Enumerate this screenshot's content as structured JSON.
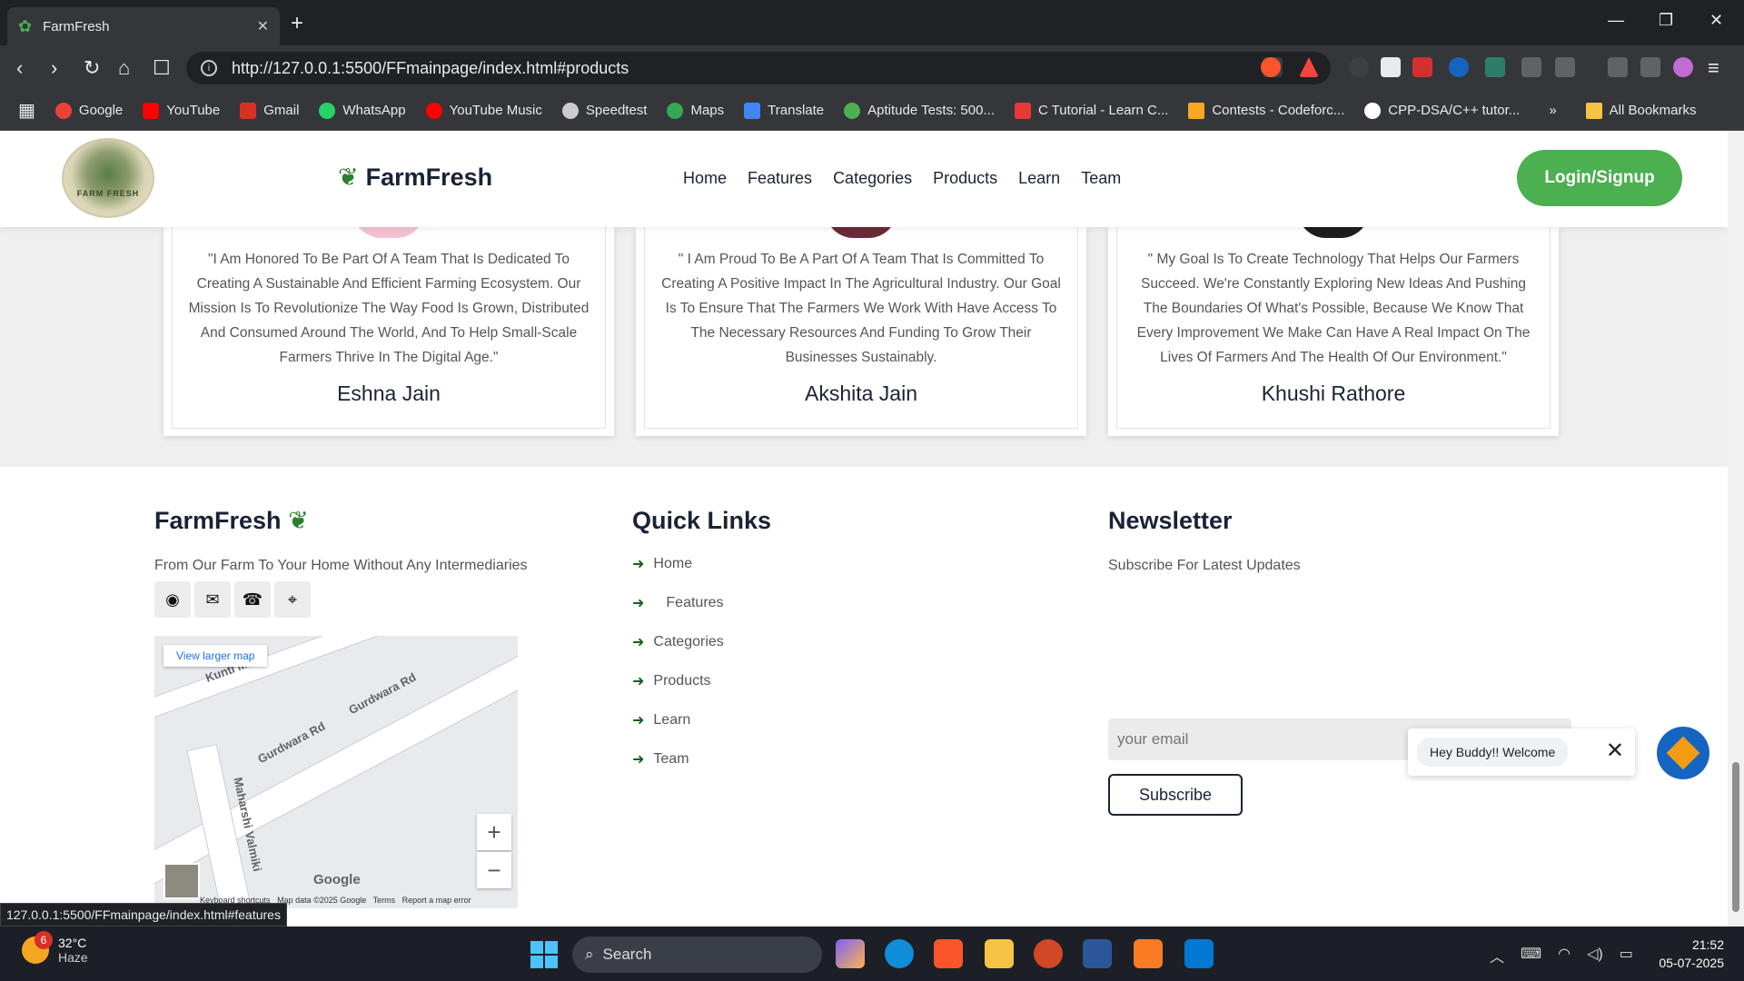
{
  "browser": {
    "tab_title": "FarmFresh",
    "url": "http://127.0.0.1:5500/FFmainpage/index.html#products",
    "status_url": "127.0.0.1:5500/FFmainpage/index.html#features",
    "bookmarks": [
      {
        "label": "Google",
        "color": "#ea4335"
      },
      {
        "label": "YouTube",
        "color": "#ff0000"
      },
      {
        "label": "Gmail",
        "color": "#d93025"
      },
      {
        "label": "WhatsApp",
        "color": "#25d366"
      },
      {
        "label": "YouTube Music",
        "color": "#ff0000"
      },
      {
        "label": "Speedtest",
        "color": "#cccccc"
      },
      {
        "label": "Maps",
        "color": "#34a853"
      },
      {
        "label": "Translate",
        "color": "#4285f4"
      },
      {
        "label": "Aptitude Tests: 500...",
        "color": "#4caf50"
      },
      {
        "label": "C Tutorial - Learn C...",
        "color": "#e53935"
      },
      {
        "label": "Contests - Codeforc...",
        "color": "#f9a825"
      },
      {
        "label": "CPP-DSA/C++ tutor...",
        "color": "#ffffff"
      }
    ],
    "all_bookmarks": "All Bookmarks"
  },
  "header": {
    "logo_text": "FARM FRESH",
    "brand": "FarmFresh",
    "nav": [
      "Home",
      "Features",
      "Categories",
      "Products",
      "Learn",
      "Team"
    ],
    "login_label": "Login/Signup"
  },
  "team": [
    {
      "quote": "\"I Am Honored To Be Part Of A Team That Is Dedicated To Creating A Sustainable And Efficient Farming Ecosystem. Our Mission Is To Revolutionize The Way Food Is Grown, Distributed And Consumed Around The World, And To Help Small-Scale Farmers Thrive In The Digital Age.\"",
      "name": "Eshna Jain",
      "avatar_color": "#f4c2cf"
    },
    {
      "quote": "\" I Am Proud To Be A Part Of A Team That Is Committed To Creating A Positive Impact In The Agricultural Industry. Our Goal Is To Ensure That The Farmers We Work With Have Access To The Necessary Resources And Funding To Grow Their Businesses Sustainably.",
      "name": "Akshita Jain",
      "avatar_color": "#6b2a35"
    },
    {
      "quote": "\" My Goal Is To Create Technology That Helps Our Farmers Succeed. We're Constantly Exploring New Ideas And Pushing The Boundaries Of What's Possible, Because We Know That Every Improvement We Make Can Have A Real Impact On The Lives Of Farmers And The Health Of Our Environment.\"",
      "name": "Khushi Rathore",
      "avatar_color": "#1e1e1e"
    }
  ],
  "footer": {
    "brand": "FarmFresh",
    "tagline": "From Our Farm To Your Home Without Any Intermediaries",
    "social_icons": [
      "github-icon",
      "envelope-icon",
      "phone-icon",
      "map-pin-icon"
    ],
    "map": {
      "view_larger": "View larger map",
      "streets": [
        "Kunti Ma",
        "Gurdwara Rd",
        "Gurdwara Rd",
        "Maharshi Valmiki"
      ],
      "google": "Google",
      "attribution": [
        "Keyboard shortcuts",
        "Map data ©2025 Google",
        "Terms",
        "Report a map error"
      ],
      "zoom_in": "+",
      "zoom_out": "−"
    },
    "quick_links_title": "Quick Links",
    "quick_links": [
      "Home",
      "Features",
      "Categories",
      "Products",
      "Learn",
      "Team"
    ],
    "newsletter_title": "Newsletter",
    "newsletter_sub": "Subscribe For Latest Updates",
    "email_placeholder": "your email",
    "subscribe_label": "Subscribe"
  },
  "chat": {
    "message": "Hey Buddy!! Welcome",
    "close": "✕"
  },
  "taskbar": {
    "weather_badge": "6",
    "temperature": "32°C",
    "condition": "Haze",
    "search": "Search",
    "time": "21:52",
    "date": "05-07-2025"
  }
}
